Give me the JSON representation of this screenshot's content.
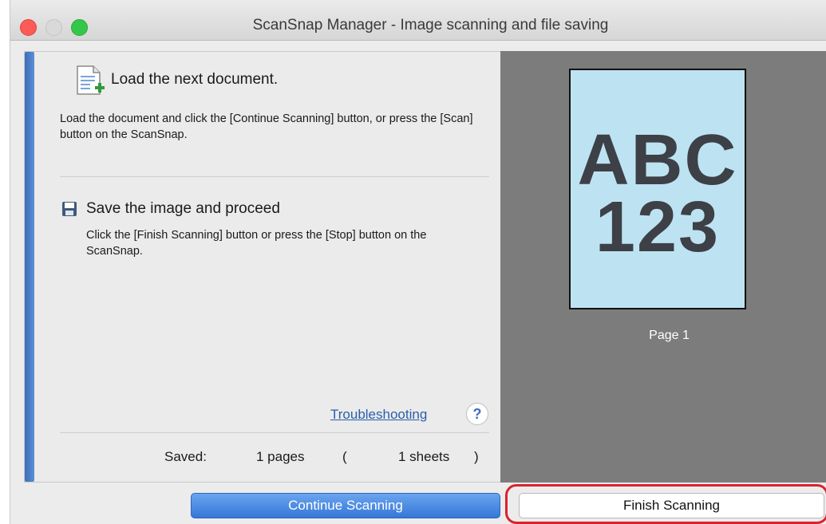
{
  "window": {
    "title": "ScanSnap Manager - Image scanning and file saving"
  },
  "instructions": {
    "heading1": "Load the next document.",
    "desc1": "Load the document and click the [Continue Scanning] button, or press the [Scan] button on the ScanSnap.",
    "heading2": "Save the image and proceed",
    "desc2": "Click the [Finish Scanning] button or press the [Stop] button on the ScanSnap."
  },
  "help": {
    "troubleshooting": "Troubleshooting",
    "help_symbol": "?"
  },
  "status": {
    "saved_label": "Saved:",
    "pages": "1 pages",
    "paren_open": "(",
    "sheets": "1 sheets",
    "paren_close": ")"
  },
  "preview": {
    "thumb_line1": "ABC",
    "thumb_line2": "123",
    "page_label": "Page 1"
  },
  "buttons": {
    "continue_label": "Continue Scanning",
    "finish_label": "Finish Scanning"
  },
  "colors": {
    "accent": "#3b6fb8",
    "highlight": "#d9232e",
    "thumb_background": "#bde3f2"
  },
  "icons": {
    "document": "document-add-icon",
    "save": "save-disk-icon",
    "help": "help-icon"
  }
}
